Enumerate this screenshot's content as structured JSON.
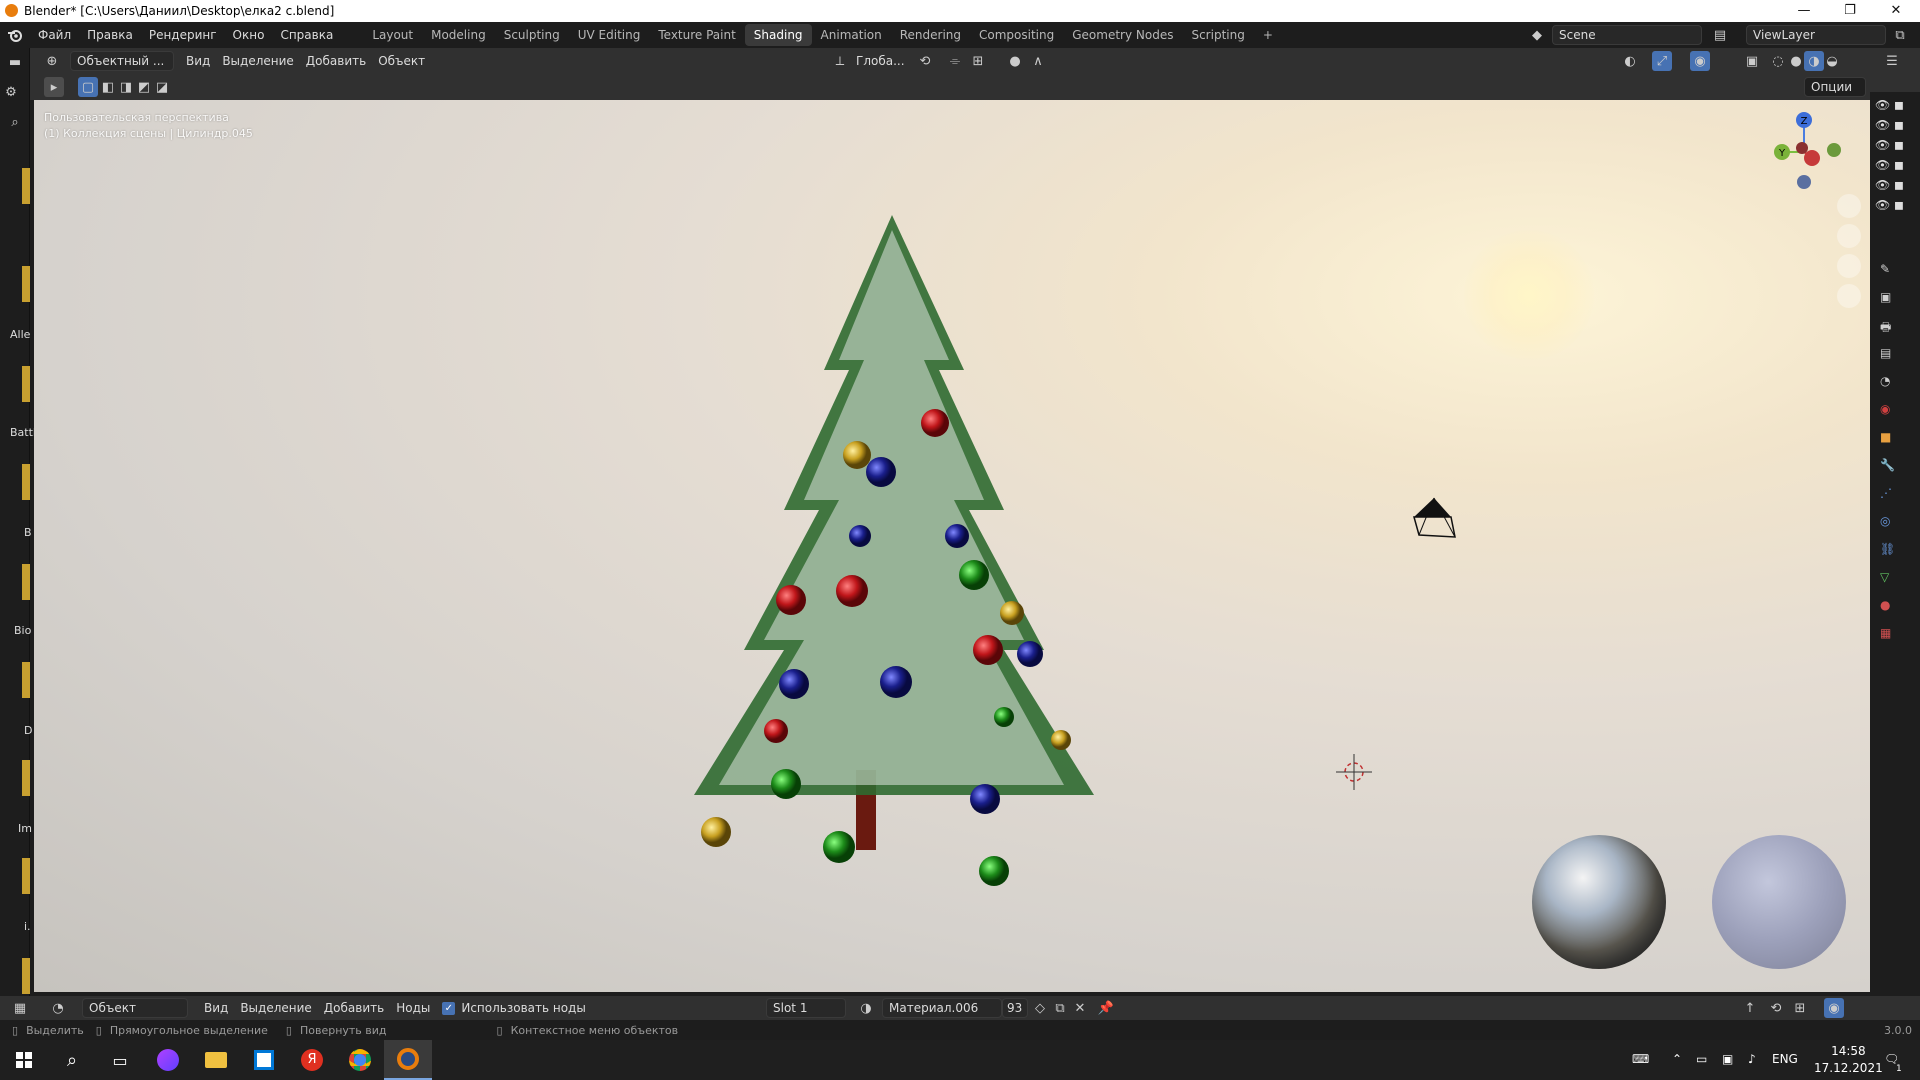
{
  "window": {
    "title": "Blender* [C:\\Users\\Даниил\\Desktop\\елка2 c.blend]",
    "minimize": "—",
    "restore": "❐",
    "close": "✕"
  },
  "menubar": {
    "menus": [
      "Файл",
      "Правка",
      "Рендеринг",
      "Окно",
      "Справка"
    ],
    "workspaces": [
      "Layout",
      "Modeling",
      "Sculpting",
      "UV Editing",
      "Texture Paint",
      "Shading",
      "Animation",
      "Rendering",
      "Compositing",
      "Geometry Nodes",
      "Scripting"
    ],
    "active_workspace": "Shading",
    "add_tab": "+",
    "scene": "Scene",
    "view_layer": "ViewLayer"
  },
  "viewport_header": {
    "mode": "Объектный ...",
    "menus": [
      "Вид",
      "Выделение",
      "Добавить",
      "Объект"
    ],
    "orientation": "Глоба...",
    "options": "Опции"
  },
  "viewport": {
    "perspective": "Пользовательская перспектива",
    "collection": "(1) Коллекция сцены | Цилиндр.045",
    "gizmo": {
      "z": "Z",
      "y": "Y"
    }
  },
  "left_strip": {
    "labels": [
      "Alle",
      "Battl",
      "B",
      "Bio",
      "D",
      "Im",
      "i."
    ]
  },
  "shader_header": {
    "mode": "Объект",
    "menus": [
      "Вид",
      "Выделение",
      "Добавить",
      "Ноды"
    ],
    "use_nodes_label": "Использовать ноды",
    "use_nodes_checked": true,
    "slot": "Slot 1",
    "material": "Материал.006",
    "users": "93"
  },
  "statusbar": {
    "select": "Выделить",
    "box_select": "Прямоугольное выделение",
    "rotate": "Повернуть вид",
    "context_menu": "Контекстное меню объектов",
    "version": "3.0.0"
  },
  "taskbar": {
    "lang": "ENG",
    "time": "14:58",
    "date": "17.12.2021",
    "notifications": "1"
  },
  "colors": {
    "accent": "#4772b3",
    "ornament_red": "#c0161a",
    "ornament_blue": "#1a1f8c",
    "ornament_green": "#1d8c1a",
    "ornament_gold": "#c8a020"
  }
}
